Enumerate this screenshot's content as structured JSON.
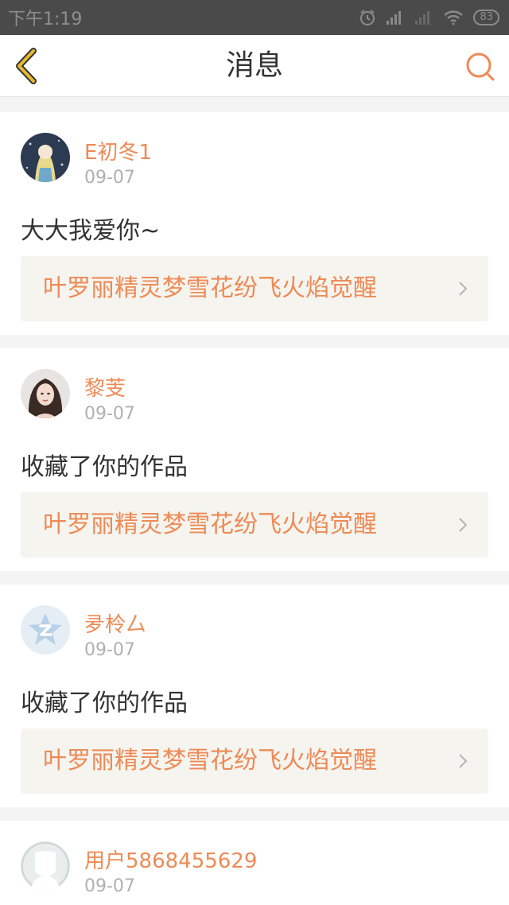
{
  "status_bar": {
    "time": "下午1:19",
    "battery": "83"
  },
  "header": {
    "title": "消息"
  },
  "messages": [
    {
      "username": "E初冬1",
      "date": "09-07",
      "text": "大大我爱你~",
      "work_title": "叶罗丽精灵梦雪花纷飞火焰觉醒"
    },
    {
      "username": "黎芰",
      "date": "09-07",
      "text": "收藏了你的作品",
      "work_title": "叶罗丽精灵梦雪花纷飞火焰觉醒"
    },
    {
      "username": "夛柃厶",
      "date": "09-07",
      "text": "收藏了你的作品",
      "work_title": "叶罗丽精灵梦雪花纷飞火焰觉醒"
    },
    {
      "username": "用户5868455629",
      "date": "09-07"
    }
  ],
  "colors": {
    "accent": "#ee8a55",
    "back_arrow": "#e8b830",
    "link_background": "#f5f4ef"
  }
}
